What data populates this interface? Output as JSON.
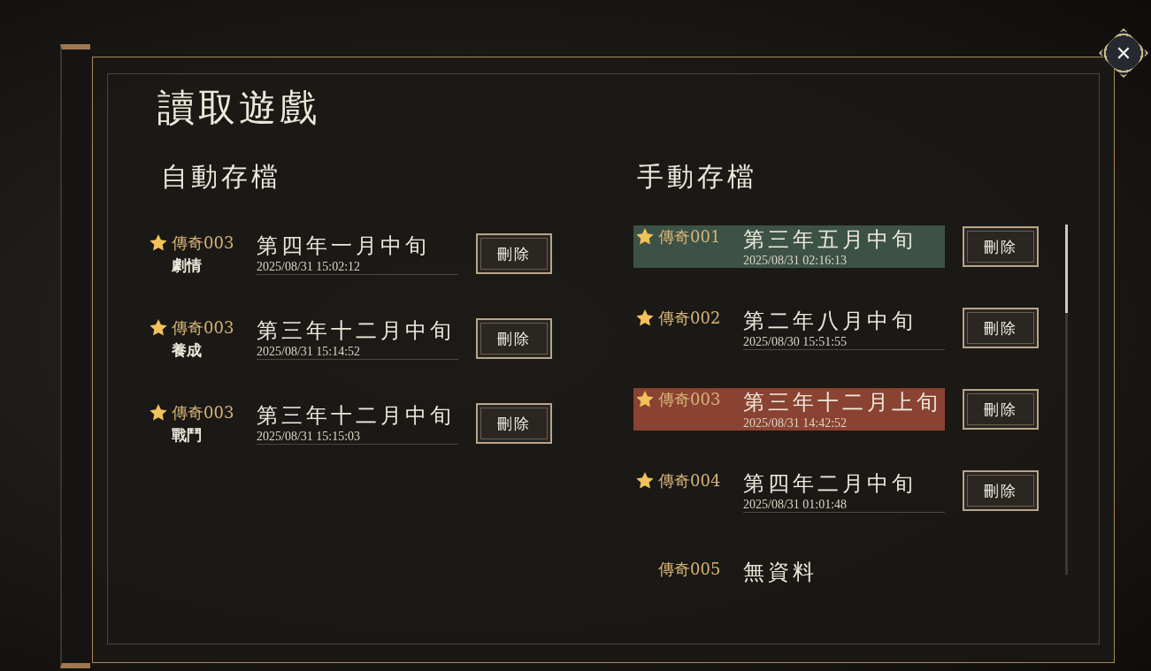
{
  "title": "讀取遊戲",
  "close_button": {
    "label": "✕"
  },
  "auto_saves": {
    "heading": "自動存檔",
    "slots": [
      {
        "kind": "save",
        "starred": true,
        "name": "傳奇003",
        "subtitle": "劇情",
        "date": "第四年一月中旬",
        "timestamp": "2025/08/31 15:02:12",
        "delete_label": "刪除"
      },
      {
        "kind": "save",
        "starred": true,
        "name": "傳奇003",
        "subtitle": "養成",
        "date": "第三年十二月中旬",
        "timestamp": "2025/08/31 15:14:52",
        "delete_label": "刪除"
      },
      {
        "kind": "save",
        "starred": true,
        "name": "傳奇003",
        "subtitle": "戰鬥",
        "date": "第三年十二月中旬",
        "timestamp": "2025/08/31 15:15:03",
        "delete_label": "刪除"
      }
    ]
  },
  "manual_saves": {
    "heading": "手動存檔",
    "slots": [
      {
        "kind": "save",
        "starred": true,
        "name": "傳奇001",
        "date": "第三年五月中旬",
        "timestamp": "2025/08/31 02:16:13",
        "delete_label": "刪除",
        "color": "#3c5246"
      },
      {
        "kind": "save",
        "starred": true,
        "name": "傳奇002",
        "date": "第二年八月中旬",
        "timestamp": "2025/08/30 15:51:55",
        "delete_label": "刪除"
      },
      {
        "kind": "save",
        "starred": true,
        "name": "傳奇003",
        "date": "第三年十二月上旬",
        "timestamp": "2025/08/31 14:42:52",
        "delete_label": "刪除",
        "color": "#8a4232"
      },
      {
        "kind": "save",
        "starred": true,
        "name": "傳奇004",
        "date": "第四年二月中旬",
        "timestamp": "2025/08/31 01:01:48",
        "delete_label": "刪除"
      },
      {
        "kind": "empty",
        "starred": false,
        "name": "傳奇005",
        "date": "無資料"
      }
    ]
  }
}
